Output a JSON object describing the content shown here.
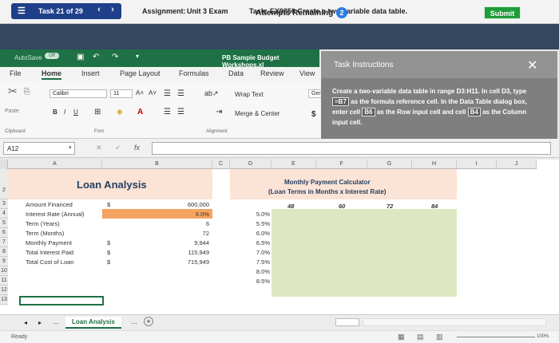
{
  "task": {
    "counter": "Task 21 of 29",
    "assignment_label": "Assignment:",
    "assignment_value": "Unit 3 Exam",
    "task_label": "Task:",
    "task_value": "EX9350 Create a two-variable data table."
  },
  "attempts": {
    "label": "Attempts Remaining",
    "count": "2",
    "submit": "Submit"
  },
  "excel": {
    "autosave": "AutoSave",
    "autosave_state": "Off",
    "file_title": "PB Sample Budget Workshops.xl",
    "tabs": [
      "File",
      "Home",
      "Insert",
      "Page Layout",
      "Formulas",
      "Data",
      "Review",
      "View"
    ],
    "font_name": "Calibri",
    "font_size": "11",
    "wrap_text": "Wrap Text",
    "merge_center": "Merge & Center",
    "paste": "Paste",
    "clipboard": "Clipboard",
    "font_group": "Font",
    "alignment_group": "Alignment",
    "number_format": "Ger",
    "name_box": "A12"
  },
  "panel": {
    "title": "Task Instructions",
    "text_parts": [
      "Create a two-variable data table in range D3:H11. In cell D3, type ",
      "=B7",
      " as the formula reference cell. In the Data Table dialog box, enter cell ",
      "B6",
      " as the Row input cell and cell ",
      "B4",
      " as the Column input cell."
    ]
  },
  "sheet": {
    "columns": [
      "A",
      "B",
      "C",
      "D",
      "E",
      "F",
      "G",
      "H",
      "I",
      "J"
    ],
    "rows": [
      "2",
      "3",
      "4",
      "5",
      "6",
      "7",
      "8",
      "9",
      "10",
      "11",
      "12",
      "13"
    ],
    "loan_title": "Loan Analysis",
    "calc_title_1": "Monthly Payment Calculator",
    "calc_title_2": "(Loan Terms in Months x Interest Rate)",
    "labels": [
      "Amount Financed",
      "Interest Rate (Annual)",
      "Term (Years)",
      "Term (Months)",
      "Monthly Payment",
      "Total Interest Paid",
      "Total Cost of Loan"
    ],
    "dollar_signs": [
      "$",
      "$",
      "$",
      "$"
    ],
    "values": [
      "600,000",
      "6.0%",
      "6",
      "72",
      "9,944",
      "115,949",
      "715,949"
    ],
    "terms": [
      "48",
      "60",
      "72",
      "84"
    ],
    "rates": [
      "5.0%",
      "5.5%",
      "6.0%",
      "6.5%",
      "7.0%",
      "7.5%",
      "8.0%",
      "8.5%"
    ]
  },
  "statusbar": {
    "sheet_tab": "Loan Analysis",
    "status": "Ready",
    "zoom": "100%"
  },
  "colors": {
    "excel_green": "#1e7145",
    "accent_blue": "#1f3f8a",
    "submit_green": "#1e9c3a",
    "input_orange": "#f4a460",
    "table_green": "#dde8c2",
    "header_peach": "#fbe3d6"
  }
}
